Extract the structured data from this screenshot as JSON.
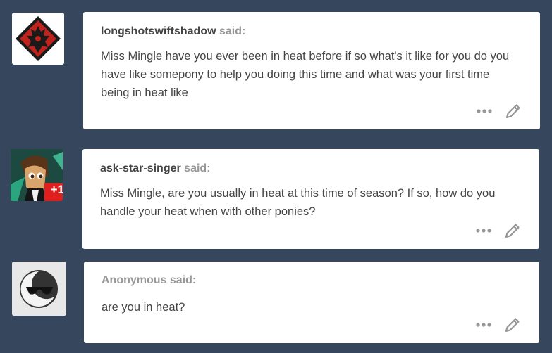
{
  "posts": [
    {
      "asker": "longshotswiftshadow",
      "said": "said:",
      "question_lines": [
        "Miss Mingle have you ever been in heat before if so what's it like for you do you",
        "have like somepony to help you doing this time and what was your first time",
        "being in heat like"
      ],
      "avatar_icon": "red-dragon-emblem-icon"
    },
    {
      "asker": "ask-star-singer",
      "said": "said:",
      "question_lines": [
        "Miss Mingle, are you usually in heat at this time of season? If so, how do you",
        "handle your heat when with other ponies?"
      ],
      "avatar_icon": "pony-avatar-icon",
      "avatar_badge": "+1"
    },
    {
      "asker": "Anonymous",
      "said": "said:",
      "question_lines": [
        "are you in heat?"
      ],
      "avatar_icon": "anonymous-sunglasses-icon"
    }
  ],
  "colors": {
    "background": "#36465d",
    "card": "#ffffff",
    "text": "#444444",
    "muted": "#979797"
  }
}
